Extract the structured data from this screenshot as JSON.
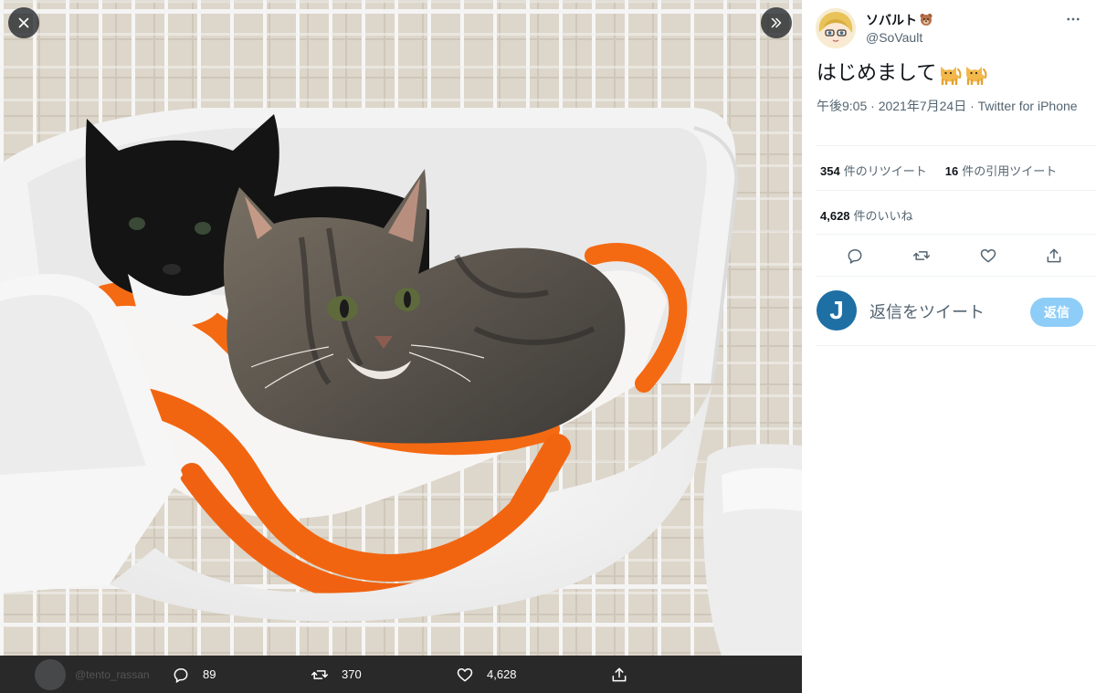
{
  "viewer": {
    "close_icon": "close-icon",
    "expand_icon": "chevrons-right-icon",
    "bar": {
      "ghost_handle": "@tento_rassan",
      "reply_count": "89",
      "retweet_count": "370",
      "like_count": "4,628"
    }
  },
  "tweet": {
    "display_name": "ソバルト",
    "handle": "@SoVault",
    "text": "はじめまして",
    "timestamp": "午後9:05 · 2021年7月24日 · Twitter for iPhone",
    "stats": {
      "retweets_value": "354",
      "retweets_label": "件のリツイート",
      "quotes_value": "16",
      "quotes_label": "件の引用ツイート",
      "likes_value": "4,628",
      "likes_label": "件のいいね"
    }
  },
  "reply": {
    "avatar_letter": "J",
    "placeholder": "返信をツイート",
    "button_label": "返信"
  },
  "colors": {
    "accent": "#1d9bf0",
    "reply_button_disabled": "#8ecdf8",
    "blanket_orange": "#f46a12"
  }
}
